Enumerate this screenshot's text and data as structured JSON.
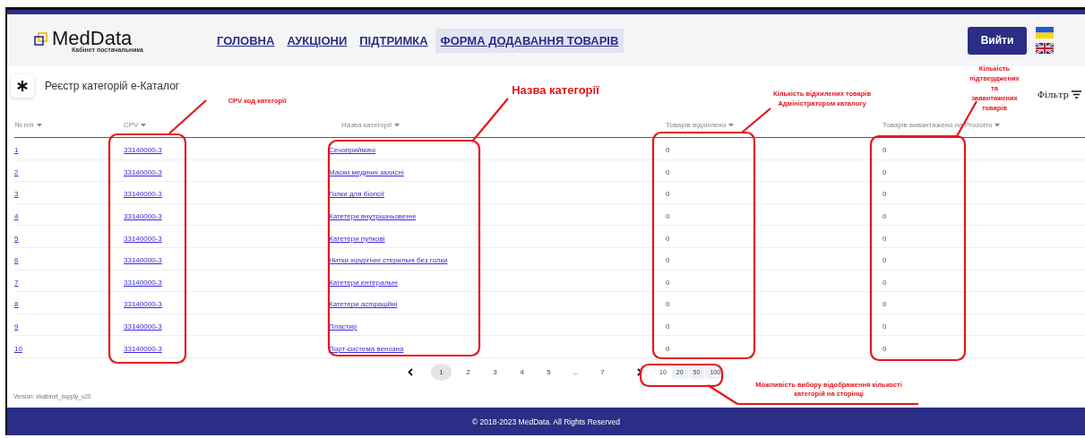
{
  "header": {
    "logo": {
      "name": "MedData",
      "subtitle": "Кабінет постачальника"
    },
    "nav": [
      {
        "label": "ГОЛОВНА",
        "selected": false
      },
      {
        "label": "АУКЦІОНИ",
        "selected": false
      },
      {
        "label": "ПІДТРИМКА",
        "selected": false
      },
      {
        "label": "ФОРМА ДОДАВАННЯ ТОВАРІВ",
        "selected": true
      }
    ],
    "logout": "Вийти"
  },
  "page_title": "Реєстр категорій е-Каталог",
  "filter": "Фільтр",
  "table": {
    "columns": [
      "№ п/п",
      "CPV",
      "Назва категорії",
      "Товарів відхилено",
      "Товарів вивантажено на Prozorro"
    ],
    "rows": [
      {
        "number": "1",
        "cpv": "33140000-3",
        "name": "Сечоприймачі",
        "rejected": "0",
        "uploaded": "0"
      },
      {
        "number": "2",
        "cpv": "33140000-3",
        "name": "Маски медичні захисні",
        "rejected": "0",
        "uploaded": "0"
      },
      {
        "number": "3",
        "cpv": "33140000-3",
        "name": "Голки для біопсії",
        "rejected": "0",
        "uploaded": "0"
      },
      {
        "number": "4",
        "cpv": "33140000-3",
        "name": "Катетери внутрішньовенні",
        "rejected": "0",
        "uploaded": "0"
      },
      {
        "number": "5",
        "cpv": "33140000-3",
        "name": "Катетери пупкові",
        "rejected": "0",
        "uploaded": "0"
      },
      {
        "number": "6",
        "cpv": "33140000-3",
        "name": "Нитки хірургічні стерильні без голки",
        "rejected": "0",
        "uploaded": "0"
      },
      {
        "number": "7",
        "cpv": "33140000-3",
        "name": "Катетери ентеральні",
        "rejected": "0",
        "uploaded": "0"
      },
      {
        "number": "8",
        "cpv": "33140000-3",
        "name": "Катетери аспіраційні",
        "rejected": "0",
        "uploaded": "0"
      },
      {
        "number": "9",
        "cpv": "33140000-3",
        "name": "Пластир",
        "rejected": "0",
        "uploaded": "0"
      },
      {
        "number": "10",
        "cpv": "33140000-3",
        "name": "Порт-система венозна",
        "rejected": "0",
        "uploaded": "0"
      }
    ]
  },
  "pagination": {
    "pages": [
      {
        "label": "1",
        "selected": true
      },
      {
        "label": "2",
        "selected": false
      },
      {
        "label": "3",
        "selected": false
      },
      {
        "label": "4",
        "selected": false
      },
      {
        "label": "5",
        "selected": false
      },
      {
        "label": "...",
        "selected": false
      },
      {
        "label": "7",
        "selected": false
      }
    ],
    "sizes": [
      {
        "label": "10",
        "selected": true
      },
      {
        "label": "20",
        "selected": false
      },
      {
        "label": "50",
        "selected": false
      },
      {
        "label": "100",
        "selected": false
      }
    ]
  },
  "version": "Version: ekabinet_supply_v20",
  "footer": "© 2018-2023 MedData. All Rights Reserved",
  "annotations": [
    {
      "text": "CPV код категорії"
    },
    {
      "text": "Назва категорії"
    },
    {
      "text": "Кількість відхилених товарів Адміністратором каталогу"
    },
    {
      "text": "Кількість підтверджених та завантажених товарів"
    },
    {
      "text": "Можливість вибору відображення кількості категорій на сторінці"
    }
  ]
}
